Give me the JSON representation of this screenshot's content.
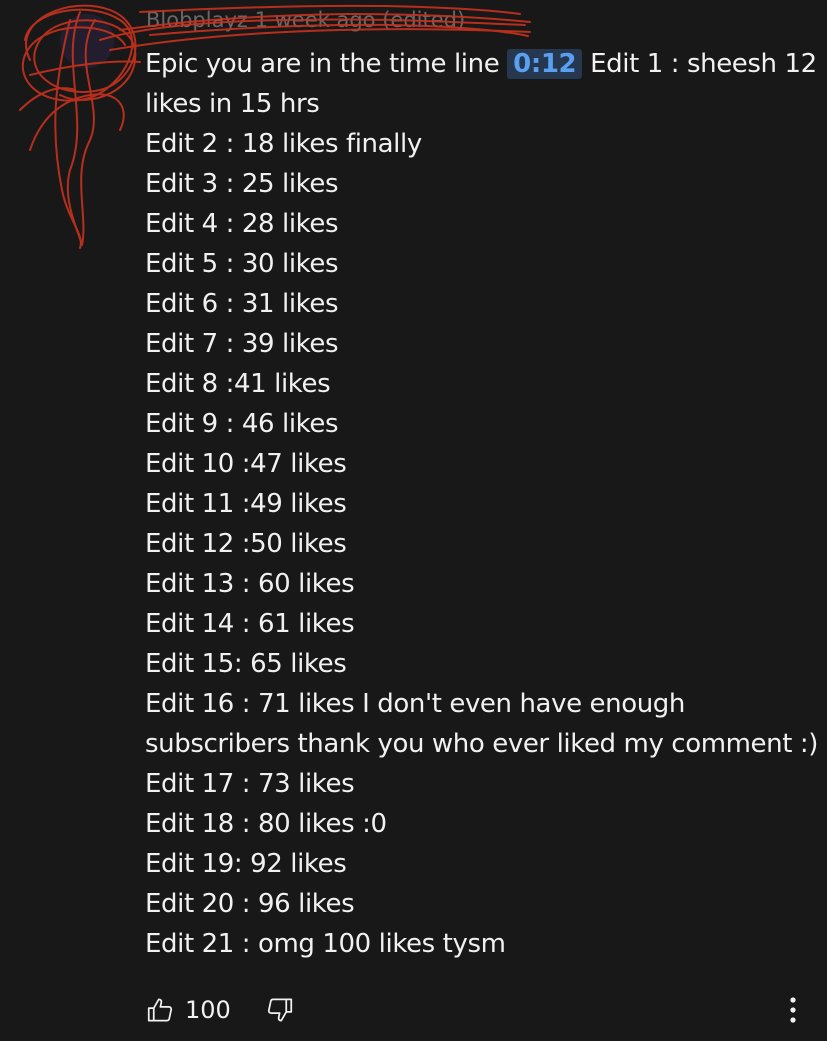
{
  "header": {
    "author": "Blobplayz",
    "time": "1 week ago (edited)"
  },
  "comment": {
    "line1_prefix": "Epic you are in the time line",
    "timestamp": "0:12",
    "line1_suffix": "Edit 1 : sheesh 12",
    "lines": [
      "likes in 15 hrs",
      "Edit 2 : 18 likes finally",
      "Edit 3 : 25 likes",
      "Edit 4 : 28 likes",
      "Edit 5 : 30 likes",
      "Edit 6 : 31 likes",
      "Edit 7 : 39 likes",
      "Edit 8 :41 likes",
      "Edit 9 : 46 likes",
      "Edit 10 :47 likes",
      "Edit 11 :49 likes",
      "Edit 12 :50 likes",
      "Edit 13 : 60 likes",
      "Edit 14 : 61 likes",
      "Edit 15: 65 likes",
      "Edit 16 : 71 likes I don't even have enough",
      "subscribers thank you who ever liked my comment :)",
      "Edit 17 : 73 likes",
      "Edit 18 : 80 likes :0",
      "Edit 19: 92 likes",
      "Edit 20 : 96 likes",
      "Edit 21 : omg 100 likes tysm"
    ]
  },
  "actions": {
    "like_count": "100",
    "like_icon": "thumbs-up-icon",
    "dislike_icon": "thumbs-down-icon",
    "more_icon": "more-vertical-icon"
  },
  "colors": {
    "background": "#181818",
    "text": "#f1f1f1",
    "timestamp_text": "#5aa0f2",
    "timestamp_bg": "#263850",
    "scribble": "#c8321e"
  }
}
